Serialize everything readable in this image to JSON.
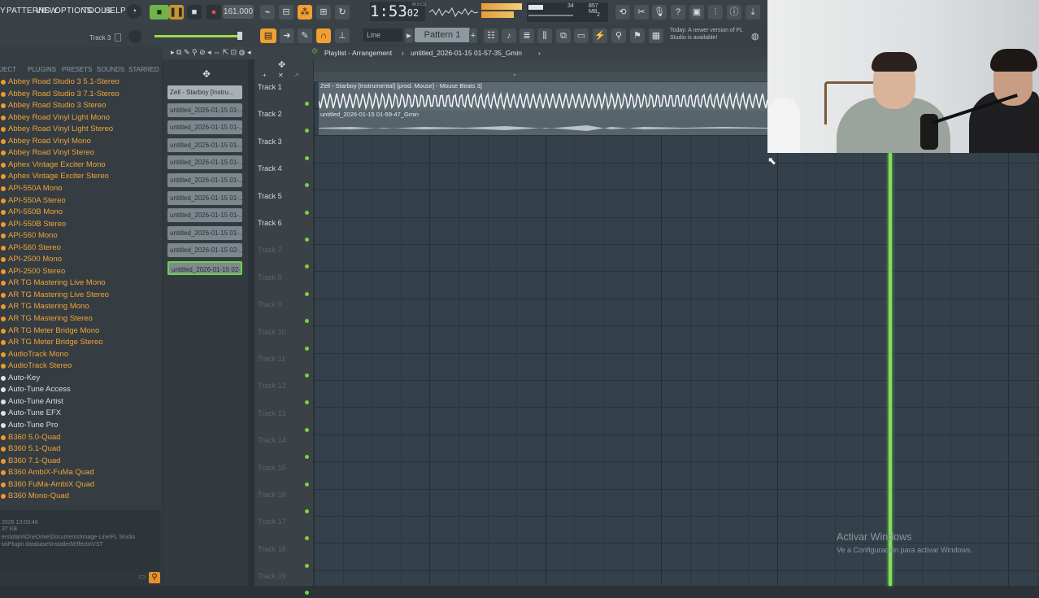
{
  "menu": [
    "PATTERNS",
    "VIEW",
    "OPTIONS",
    "TOOLS",
    "HELP"
  ],
  "menu_lead": "Y",
  "transport": {
    "time": "1:53",
    "time_small": "02",
    "time_tag": "M:S:CS",
    "bpm": "161.000",
    "mem": "857 MB",
    "cpu": "34",
    "voices": "2"
  },
  "hint": {
    "label": "Track 3"
  },
  "toolbar2": {
    "snap": "Line",
    "pattern": "Pattern 1",
    "update_news": "Today: A newer version of FL Studio is available!"
  },
  "browser": {
    "tabs": [
      "JECT",
      "PLUGINS",
      "PRESETS",
      "SOUNDS",
      "STARRED"
    ],
    "items": [
      {
        "label": "Abbey Road Studio 3 5.1-Stereo",
        "kind": "orange"
      },
      {
        "label": "Abbey Road Studio 3 7.1-Stereo",
        "kind": "orange"
      },
      {
        "label": "Abbey Road Studio 3 Stereo",
        "kind": "orange"
      },
      {
        "label": "Abbey Road Vinyl Light Mono",
        "kind": "orange"
      },
      {
        "label": "Abbey Road Vinyl Light Stereo",
        "kind": "orange"
      },
      {
        "label": "Abbey Road Vinyl Mono",
        "kind": "orange"
      },
      {
        "label": "Abbey Road Vinyl Stereo",
        "kind": "orange"
      },
      {
        "label": "Aphex Vintage Exciter Mono",
        "kind": "orange"
      },
      {
        "label": "Aphex Vintage Exciter Stereo",
        "kind": "orange"
      },
      {
        "label": "API-550A Mono",
        "kind": "orange"
      },
      {
        "label": "API-550A Stereo",
        "kind": "orange"
      },
      {
        "label": "API-550B Mono",
        "kind": "orange"
      },
      {
        "label": "API-550B Stereo",
        "kind": "orange"
      },
      {
        "label": "API-560 Mono",
        "kind": "orange"
      },
      {
        "label": "API-560 Stereo",
        "kind": "orange"
      },
      {
        "label": "API-2500 Mono",
        "kind": "orange"
      },
      {
        "label": "API-2500 Stereo",
        "kind": "orange"
      },
      {
        "label": "AR TG Mastering Live Mono",
        "kind": "orange"
      },
      {
        "label": "AR TG Mastering Live Stereo",
        "kind": "orange"
      },
      {
        "label": "AR TG Mastering Mono",
        "kind": "orange"
      },
      {
        "label": "AR TG Mastering Stereo",
        "kind": "orange"
      },
      {
        "label": "AR TG Meter Bridge Mono",
        "kind": "orange"
      },
      {
        "label": "AR TG Meter Bridge Stereo",
        "kind": "orange"
      },
      {
        "label": "AudioTrack Mono",
        "kind": "orange"
      },
      {
        "label": "AudioTrack Stereo",
        "kind": "orange"
      },
      {
        "label": "Auto-Key",
        "kind": "white"
      },
      {
        "label": "Auto-Tune Access",
        "kind": "white"
      },
      {
        "label": "Auto-Tune Artist",
        "kind": "white"
      },
      {
        "label": "Auto-Tune EFX",
        "kind": "white"
      },
      {
        "label": "Auto-Tune Pro",
        "kind": "white"
      },
      {
        "label": "B360 5.0-Quad",
        "kind": "orange"
      },
      {
        "label": "B360 5.1-Quad",
        "kind": "orange"
      },
      {
        "label": "B360 7.1-Quad",
        "kind": "orange"
      },
      {
        "label": "B360 AmbiX-FuMa Quad",
        "kind": "orange"
      },
      {
        "label": "B360 FuMa-AmbiX Quad",
        "kind": "orange"
      },
      {
        "label": "B360 Mono-Quad",
        "kind": "orange"
      }
    ],
    "footer": [
      "2026 13:03:46",
      "37 KB",
      "ers\\otani\\OneDrive\\Documents\\Image-Line\\FL Studio",
      "ta\\Plugin database\\Installed\\Effects\\VST"
    ]
  },
  "playlist": {
    "title": "Playlist - Arrangement",
    "project": "untitled_2026-01-15 01-57-35_Gmin",
    "picker": [
      "Zell - Starboy [Instru...",
      "untitled_2026-01-15 01-...",
      "untitled_2026-01-15 01-...",
      "untitled_2026-01-15 01-...",
      "untitled_2026-01-15 01-...",
      "untitled_2026-01-15 01-...",
      "untitled_2026-01-15 01-...",
      "untitled_2026-01-15 01-...",
      "untitled_2026-01-15 01-...",
      "untitled_2026-01-15 02-...",
      "untitled_2026-01-15 02-..."
    ],
    "tracks": [
      "Track 1",
      "Track 2",
      "Track 3",
      "Track 4",
      "Track 5",
      "Track 6",
      "Track 7",
      "Track 8",
      "Track 9",
      "Track 10",
      "Track 11",
      "Track 12",
      "Track 13",
      "Track 14",
      "Track 15",
      "Track 16",
      "Track 17",
      "Track 18",
      "Track 19"
    ],
    "clips": [
      {
        "label": "Zell - Starboy [Instrumental] [prod. Mouse] - Mouse Beats 3]"
      },
      {
        "label": "untitled_2026-01-15 01-59-47_Gmin"
      }
    ]
  },
  "windows_watermark": {
    "title": "Activar Windows",
    "subtitle": "Ve a Configuración para activar Windows."
  }
}
